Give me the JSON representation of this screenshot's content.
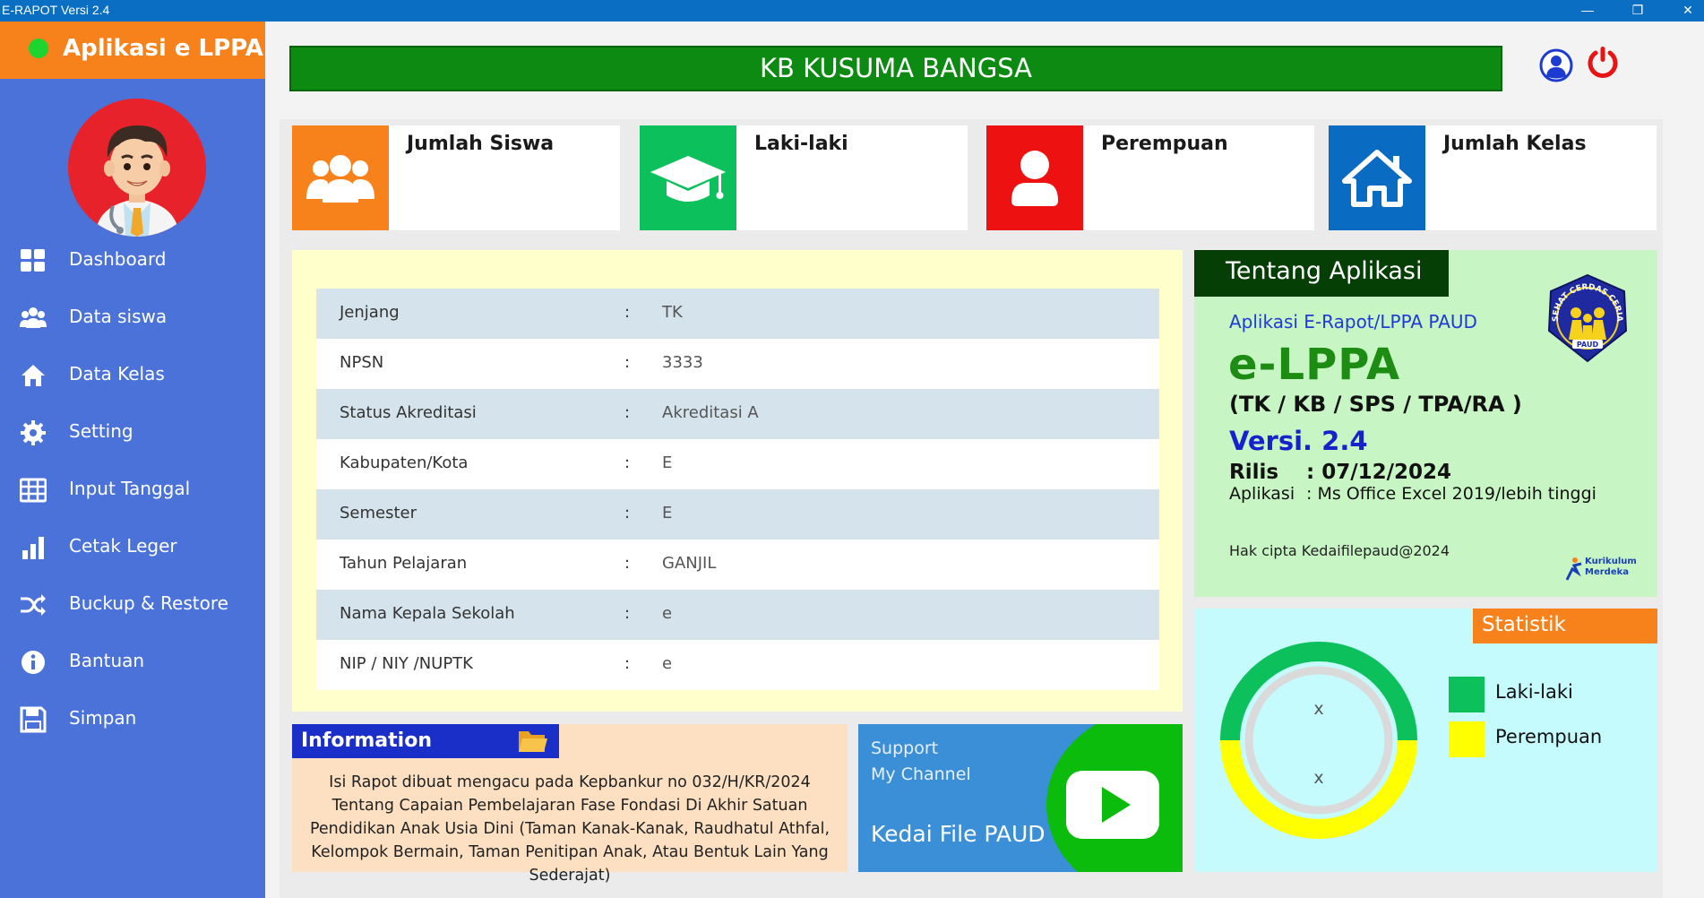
{
  "window": {
    "title": "E-RAPOT Versi 2.4",
    "minimize": "—",
    "restore": "❐",
    "close": "✕"
  },
  "sidebar": {
    "app_name": "Aplikasi e LPPA",
    "status_color": "#1ed42e",
    "items": [
      {
        "label": "Dashboard",
        "icon": "dashboard-grid-icon"
      },
      {
        "label": "Data siswa",
        "icon": "users-icon"
      },
      {
        "label": "Data Kelas",
        "icon": "home-icon"
      },
      {
        "label": "Setting",
        "icon": "gear-icon"
      },
      {
        "label": "Input Tanggal",
        "icon": "table-grid-icon"
      },
      {
        "label": "Cetak Leger",
        "icon": "bar-chart-icon"
      },
      {
        "label": "Buckup & Restore",
        "icon": "shuffle-icon"
      },
      {
        "label": "Bantuan",
        "icon": "info-icon"
      },
      {
        "label": "Simpan",
        "icon": "save-icon"
      }
    ]
  },
  "header": {
    "school_name": "KB KUSUMA BANGSA"
  },
  "stats": [
    {
      "label": "Jumlah Siswa",
      "color": "#f7821b",
      "icon": "users-icon"
    },
    {
      "label": "Laki-laki",
      "color": "#0cc15c",
      "icon": "graduation-cap-icon"
    },
    {
      "label": "Perempuan",
      "color": "#ee1111",
      "icon": "user-icon"
    },
    {
      "label": "Jumlah Kelas",
      "color": "#0a6bc2",
      "icon": "home-icon"
    }
  ],
  "profile": {
    "separator": ":",
    "rows": [
      {
        "key": "Jenjang",
        "value": "TK"
      },
      {
        "key": "NPSN",
        "value": "3333"
      },
      {
        "key": "Status Akreditasi",
        "value": "Akreditasi A"
      },
      {
        "key": "Kabupaten/Kota",
        "value": "E"
      },
      {
        "key": "Semester",
        "value": "E"
      },
      {
        "key": "Tahun Pelajaran",
        "value": "GANJIL"
      },
      {
        "key": "Nama Kepala Sekolah",
        "value": "e"
      },
      {
        "key": "NIP / NIY /NUPTK",
        "value": "e"
      }
    ]
  },
  "information": {
    "title": "Information",
    "text": "Isi Rapot dibuat mengacu pada Kepbankur no 032/H/KR/2024 Tentang Capaian Pembelajaran Fase Fondasi Di Akhir Satuan Pendidikan Anak Usia Dini (Taman Kanak-Kanak, Raudhatul Athfal, Kelompok Bermain, Taman Penitipan Anak, Atau Bentuk Lain Yang Sederajat)"
  },
  "support": {
    "line1": "Support",
    "line2": "My Channel",
    "channel": "Kedai File PAUD"
  },
  "about": {
    "title": "Tentang Aplikasi",
    "subtitle": "Aplikasi E-Rapot/LPPA PAUD",
    "app": "e-LPPA",
    "types": "(TK / KB / SPS / TPA/RA )",
    "version": "Versi. 2.4",
    "rilis_label": "Rilis",
    "rilis_value": ": 07/12/2024",
    "aplikasi_label": "Aplikasi",
    "aplikasi_value": ": Ms Office Excel 2019/lebih tinggi",
    "copyright": "Hak cipta Kedaifilepaud@2024",
    "logo_text": "SEHAT CERDAS CERIA",
    "logo_badge": "PAUD",
    "kurikulum_line1": "Kurikulum",
    "kurikulum_line2": "Merdeka"
  },
  "statistik": {
    "title": "Statistik",
    "value_laki": "x",
    "value_perempuan": "x",
    "legend": [
      {
        "label": "Laki-laki",
        "color": "#0cc15c"
      },
      {
        "label": "Perempuan",
        "color": "#ffff00"
      }
    ]
  }
}
